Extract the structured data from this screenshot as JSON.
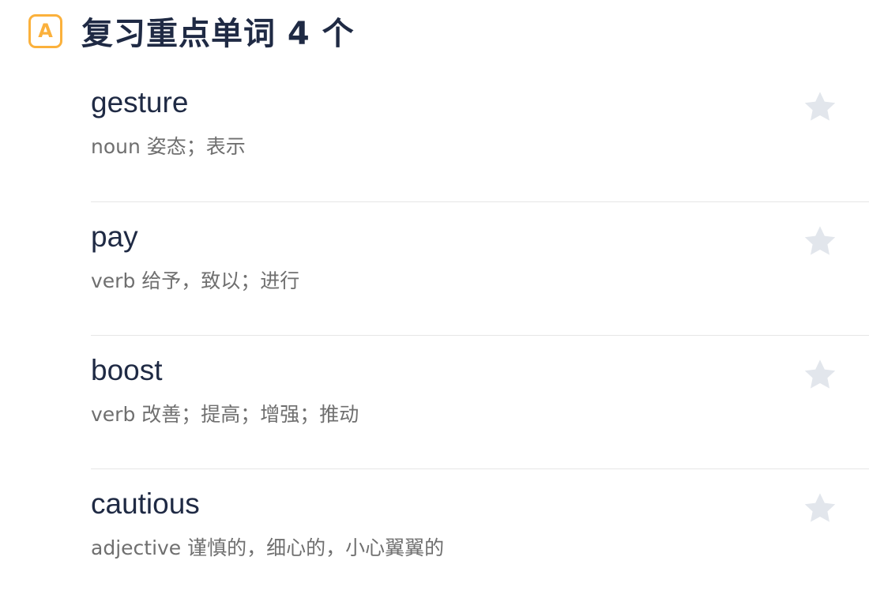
{
  "header": {
    "badge_letter": "A",
    "title": "复习重点单词 4 个"
  },
  "colors": {
    "accent": "#fbb13c",
    "title_text": "#1f2a44",
    "definition_text": "#6f6f6f",
    "star_inactive": "#e2e6ec",
    "divider": "#e6e6e6"
  },
  "words": [
    {
      "word": "gesture",
      "definition": "noun 姿态；表示",
      "starred": false,
      "icon": "star-icon"
    },
    {
      "word": "pay",
      "definition": "verb 给予，致以；进行",
      "starred": false,
      "icon": "star-icon"
    },
    {
      "word": "boost",
      "definition": "verb 改善；提高；增强；推动",
      "starred": false,
      "icon": "star-icon"
    },
    {
      "word": "cautious",
      "definition": "adjective 谨慎的，细心的，小心翼翼的",
      "starred": false,
      "icon": "star-icon"
    }
  ]
}
